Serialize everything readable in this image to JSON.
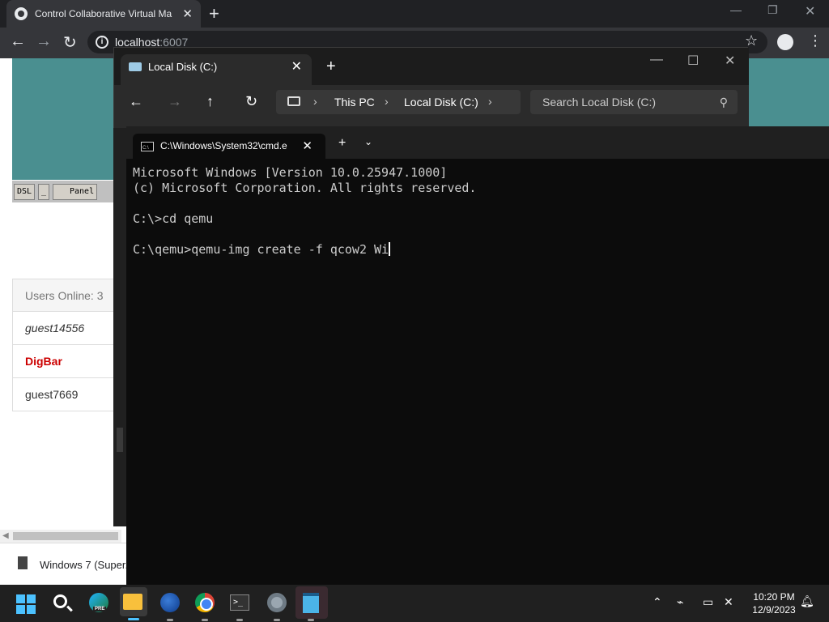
{
  "chrome": {
    "tab_title": "Control Collaborative Virtual Ma",
    "url_host": "localhost",
    "url_port": ":6007"
  },
  "vm_page": {
    "taskbar_buttons": [
      "DSL",
      "_",
      "Panel"
    ],
    "users_header": "Users Online: 3",
    "users": [
      {
        "name": "guest14556",
        "style": "italic"
      },
      {
        "name": "DigBar",
        "style": "admin"
      },
      {
        "name": "guest7669",
        "style": "normal"
      }
    ],
    "download_file": "Windows 7 (Super."
  },
  "explorer": {
    "tab_title": "Local Disk (C:)",
    "breadcrumb": [
      "This PC",
      "Local Disk (C:)"
    ],
    "search_placeholder": "Search Local Disk (C:)"
  },
  "terminal": {
    "tab_title": "C:\\Windows\\System32\\cmd.e",
    "lines": [
      "Microsoft Windows [Version 10.0.25947.1000]",
      "(c) Microsoft Corporation. All rights reserved.",
      "",
      "C:\\>cd qemu",
      "",
      "C:\\qemu>qemu-img create -f qcow2 Wi"
    ]
  },
  "taskbar": {
    "edge_badge": "PRE",
    "time": "10:20 PM",
    "date": "12/9/2023",
    "pinned_apps": [
      "start-icon",
      "search-icon",
      "edge-icon",
      "file-explorer-icon",
      "firefox-icon",
      "chrome-icon",
      "terminal-icon",
      "settings-icon",
      "notepad-icon"
    ]
  },
  "colors": {
    "vm_teal": "#4a8f90",
    "admin_user": "#cc0000",
    "terminal_bg": "#0c0c0c"
  }
}
